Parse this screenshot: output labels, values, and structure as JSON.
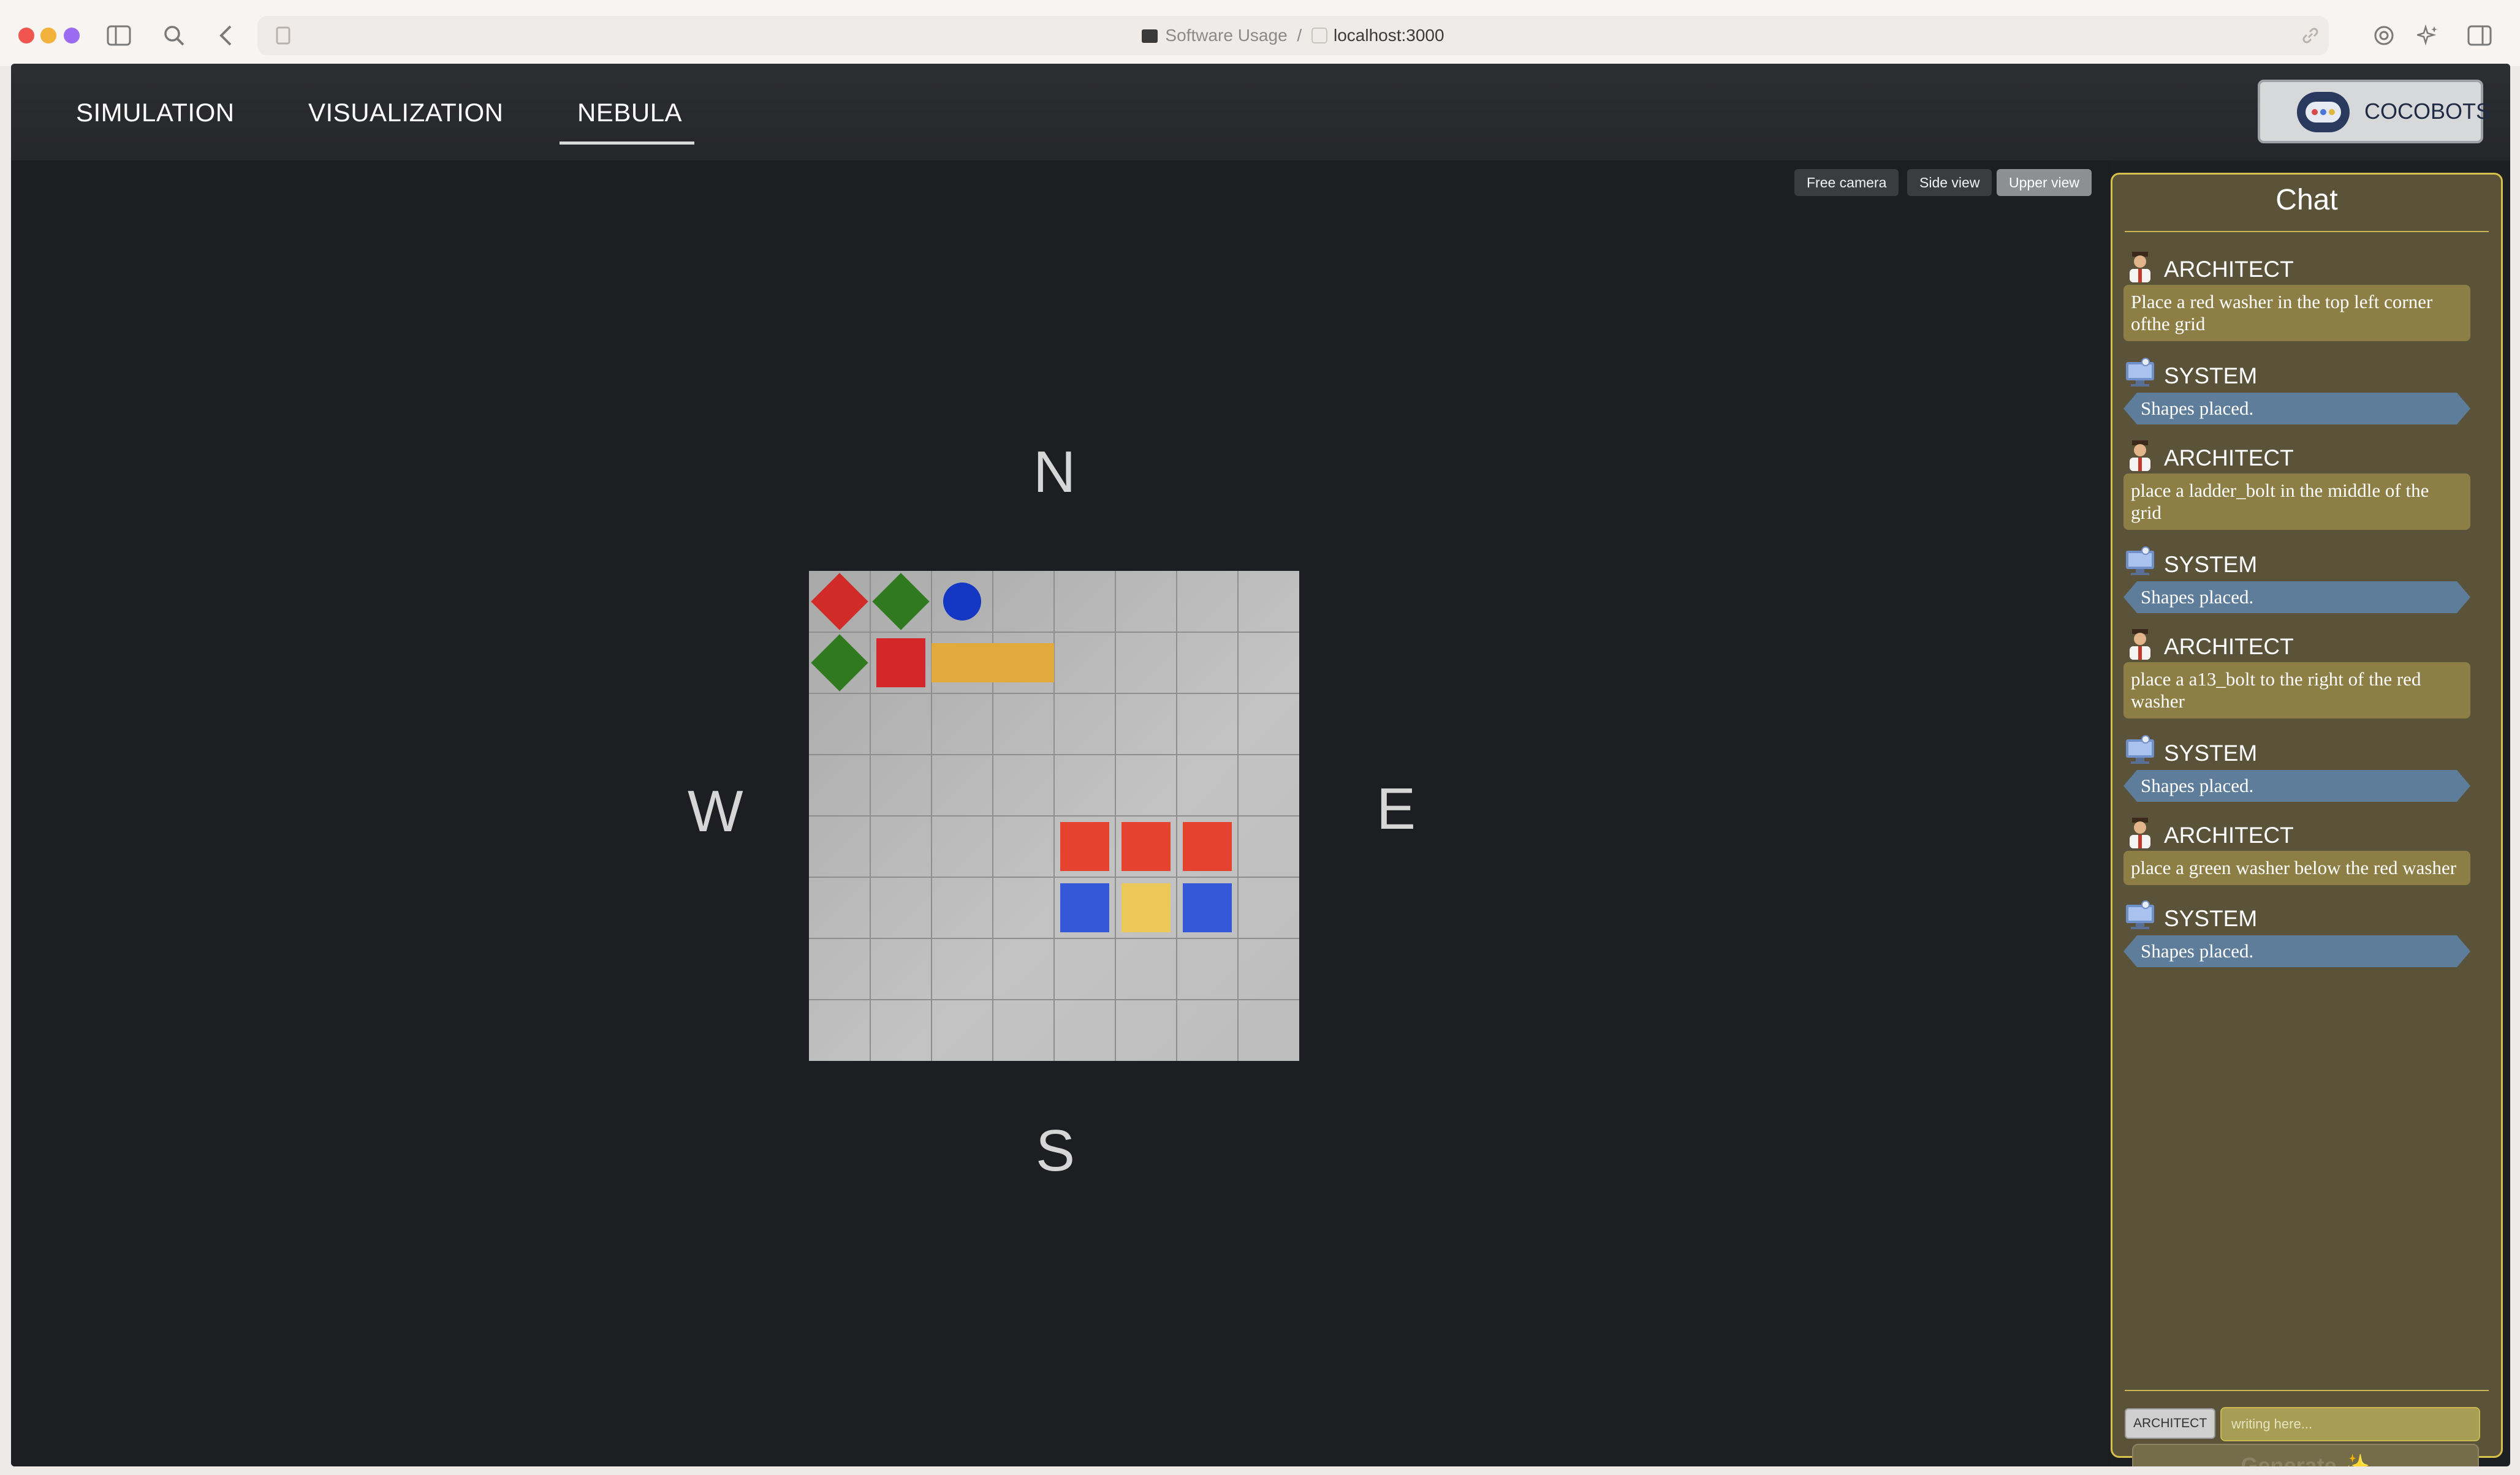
{
  "browser": {
    "site_name": "Software Usage",
    "separator": "/",
    "url": "localhost:3000"
  },
  "nav": {
    "tabs": [
      {
        "label": "SIMULATION"
      },
      {
        "label": "VISUALIZATION"
      },
      {
        "label": "NEBULA",
        "active": true
      }
    ],
    "brand_label": "COCOBOTS"
  },
  "camera": {
    "buttons": [
      {
        "label": "Free camera"
      },
      {
        "label": "Side view"
      },
      {
        "label": "Upper view",
        "active": true
      }
    ]
  },
  "compass": {
    "north": "N",
    "south": "S",
    "east": "E",
    "west": "W"
  },
  "grid": {
    "rows": 8,
    "cols": 8,
    "pieces": [
      {
        "shape": "diamond",
        "color": "#d12b27",
        "row": 0,
        "col": 0
      },
      {
        "shape": "diamond",
        "color": "#2f7a1f",
        "row": 0,
        "col": 1
      },
      {
        "shape": "circle",
        "color": "#1437c4",
        "row": 0,
        "col": 2
      },
      {
        "shape": "diamond",
        "color": "#2f7a1f",
        "row": 1,
        "col": 0
      },
      {
        "shape": "square",
        "color": "#d4272a",
        "row": 1,
        "col": 1
      },
      {
        "shape": "bar",
        "color": "#e2a93c",
        "row": 1,
        "col": 2,
        "span": 2
      },
      {
        "shape": "square",
        "color": "#e5432f",
        "row": 4,
        "col": 4
      },
      {
        "shape": "square",
        "color": "#e5432f",
        "row": 4,
        "col": 5
      },
      {
        "shape": "square",
        "color": "#e5432f",
        "row": 4,
        "col": 6
      },
      {
        "shape": "square",
        "color": "#3558d8",
        "row": 5,
        "col": 4
      },
      {
        "shape": "square",
        "color": "#ebc857",
        "row": 5,
        "col": 5
      },
      {
        "shape": "square",
        "color": "#3558d8",
        "row": 5,
        "col": 6
      }
    ]
  },
  "chat": {
    "title": "Chat",
    "messages": [
      {
        "author": "ARCHITECT",
        "text": "Place a red washer in the top left corner ofthe grid"
      },
      {
        "author": "SYSTEM",
        "text": "Shapes placed."
      },
      {
        "author": "ARCHITECT",
        "text": "place a ladder_bolt in the middle of the grid"
      },
      {
        "author": "SYSTEM",
        "text": "Shapes placed."
      },
      {
        "author": "ARCHITECT",
        "text": "place a a13_bolt to the right of the red washer"
      },
      {
        "author": "SYSTEM",
        "text": "Shapes placed."
      },
      {
        "author": "ARCHITECT",
        "text": "place a green washer below the red washer"
      },
      {
        "author": "SYSTEM",
        "text": "Shapes placed."
      }
    ],
    "role_badge": "ARCHITECT",
    "input_placeholder": "writing here...",
    "input_value": "",
    "generate_label": "Generate",
    "generate_icon": "sparkle-icon"
  }
}
